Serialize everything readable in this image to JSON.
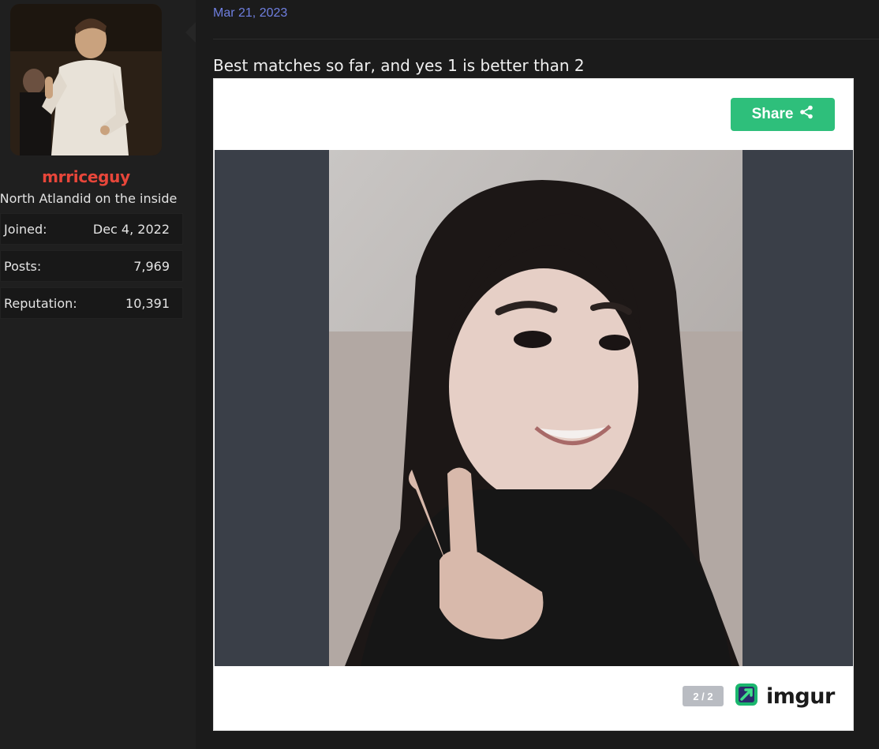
{
  "user": {
    "username": "mrriceguy",
    "title": "North Atlandid on the inside",
    "stats": [
      {
        "label": "Joined:",
        "value": "Dec 4, 2022"
      },
      {
        "label": "Posts:",
        "value": "7,969"
      },
      {
        "label": "Reputation:",
        "value": "10,391"
      }
    ],
    "username_color": "#e8463a"
  },
  "post": {
    "date": "Mar 21, 2023",
    "text": "Best matches so far, and yes 1 is better than 2"
  },
  "embed": {
    "share_label": "Share",
    "counter": "2 / 2",
    "brand": "imgur",
    "share_color": "#2ebf7b",
    "icons": [
      "share-icon",
      "imgur-logo-icon"
    ]
  }
}
